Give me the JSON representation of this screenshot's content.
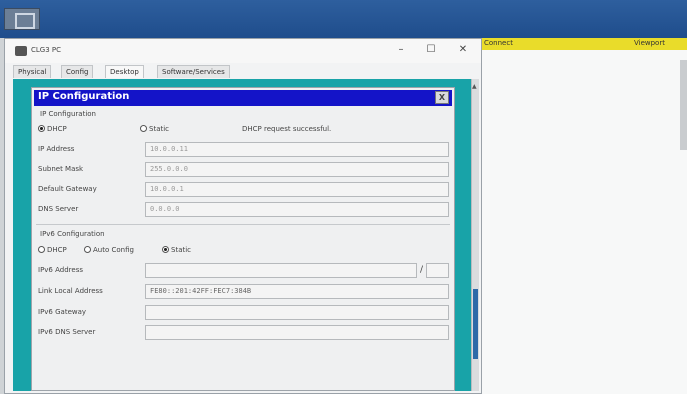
{
  "background": {
    "header_left": "Connect",
    "header_right": "Viewport"
  },
  "pc_window": {
    "title": "CLG3 PC",
    "minimize": "–",
    "maximize": "☐",
    "close": "✕",
    "tabs": [
      "Physical",
      "Config",
      "Desktop",
      "Software/Services"
    ],
    "active_tab": "Desktop"
  },
  "ip_config": {
    "title": "IP Configuration",
    "close": "X",
    "ipv4_section": "IP Configuration",
    "dhcp_label": "DHCP",
    "static_label": "Static",
    "status": "DHCP request successful.",
    "fields": [
      {
        "label": "IP Address",
        "value": "10.0.0.11"
      },
      {
        "label": "Subnet Mask",
        "value": "255.0.0.0"
      },
      {
        "label": "Default Gateway",
        "value": "10.0.0.1"
      },
      {
        "label": "DNS Server",
        "value": "0.0.0.0"
      }
    ],
    "ipv6_section": "IPv6 Configuration",
    "ipv6_dhcp": "DHCP",
    "ipv6_auto": "Auto Config",
    "ipv6_static": "Static",
    "ipv6_fields": [
      {
        "label": "IPv6 Address",
        "value": ""
      },
      {
        "label": "Link Local Address",
        "value": "FE80::201:42FF:FEC7:384B"
      },
      {
        "label": "IPv6 Gateway",
        "value": ""
      },
      {
        "label": "IPv6 DNS Server",
        "value": ""
      }
    ],
    "prefix_separator": "/",
    "prefix_value": ""
  }
}
